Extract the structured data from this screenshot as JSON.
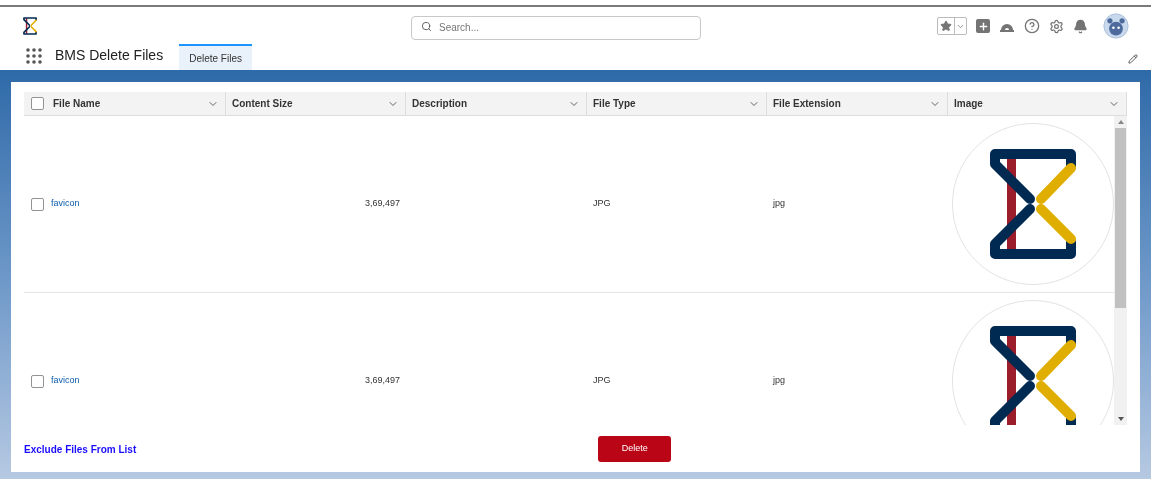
{
  "header": {
    "search": {
      "placeholder": "Search..."
    }
  },
  "nav": {
    "app_name": "BMS Delete Files",
    "tabs": [
      {
        "label": "Delete Files",
        "selected": true
      }
    ]
  },
  "table": {
    "select_all": {
      "checked": false
    },
    "columns": [
      "File Name",
      "Content Size",
      "Description",
      "File Type",
      "File Extension",
      "Image"
    ],
    "rows": [
      {
        "checked": false,
        "file_name": "favicon",
        "content_size": "3,69,497",
        "description": "",
        "file_type": "JPG",
        "file_extension": "jpg"
      },
      {
        "checked": false,
        "file_name": "favicon",
        "content_size": "3,69,497",
        "description": "",
        "file_type": "JPG",
        "file_extension": "jpg"
      }
    ]
  },
  "footer": {
    "link": "Exclude Files From List",
    "button": "Delete"
  }
}
